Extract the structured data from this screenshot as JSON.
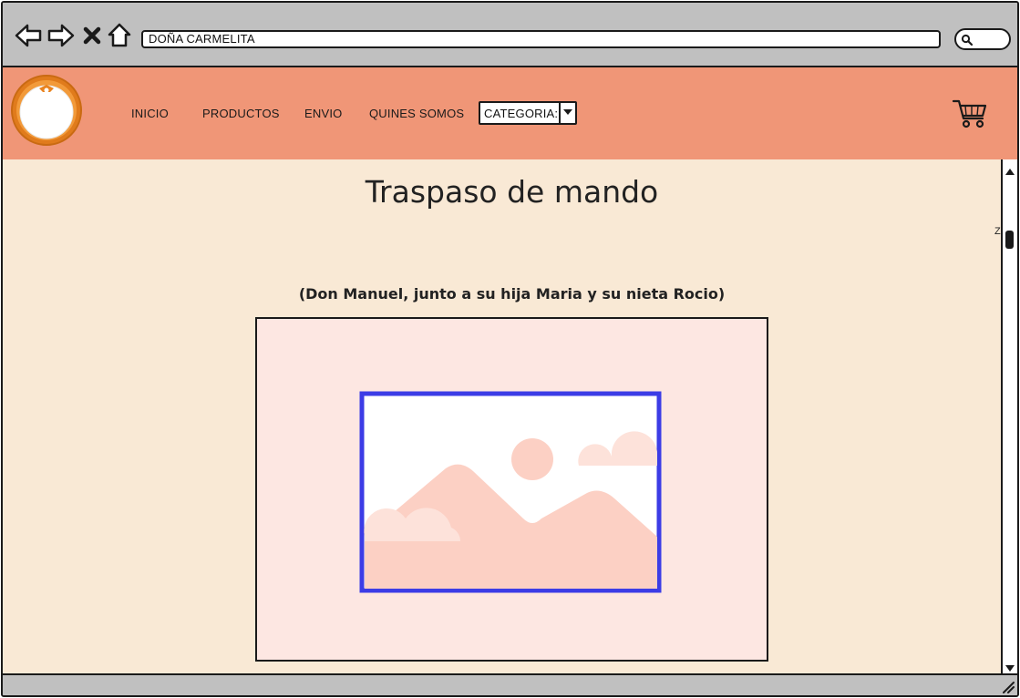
{
  "browser": {
    "url": "DOÑA CARMELITA",
    "icons": [
      "back-arrow-icon",
      "forward-arrow-icon",
      "close-icon",
      "home-icon",
      "search-icon"
    ]
  },
  "header": {
    "menu": [
      {
        "label": "INICIO"
      },
      {
        "label": "PRODUCTOS"
      },
      {
        "label": "ENVIO"
      },
      {
        "label": "QUINES SOMOS"
      }
    ],
    "category_select": {
      "value": "CATEGORIA:"
    },
    "colors": {
      "header_bg": "#f09677",
      "logo_orange": "#e07b1c"
    }
  },
  "main": {
    "title": "Traspaso de mando",
    "caption": "(Don Manuel, junto a su hija Maria y su nieta Rocio)",
    "side_marker": "Z",
    "colors": {
      "page_bg": "#f9e9d5",
      "frame_bg": "#fde7e2",
      "image_border": "#3c3ce6"
    }
  }
}
